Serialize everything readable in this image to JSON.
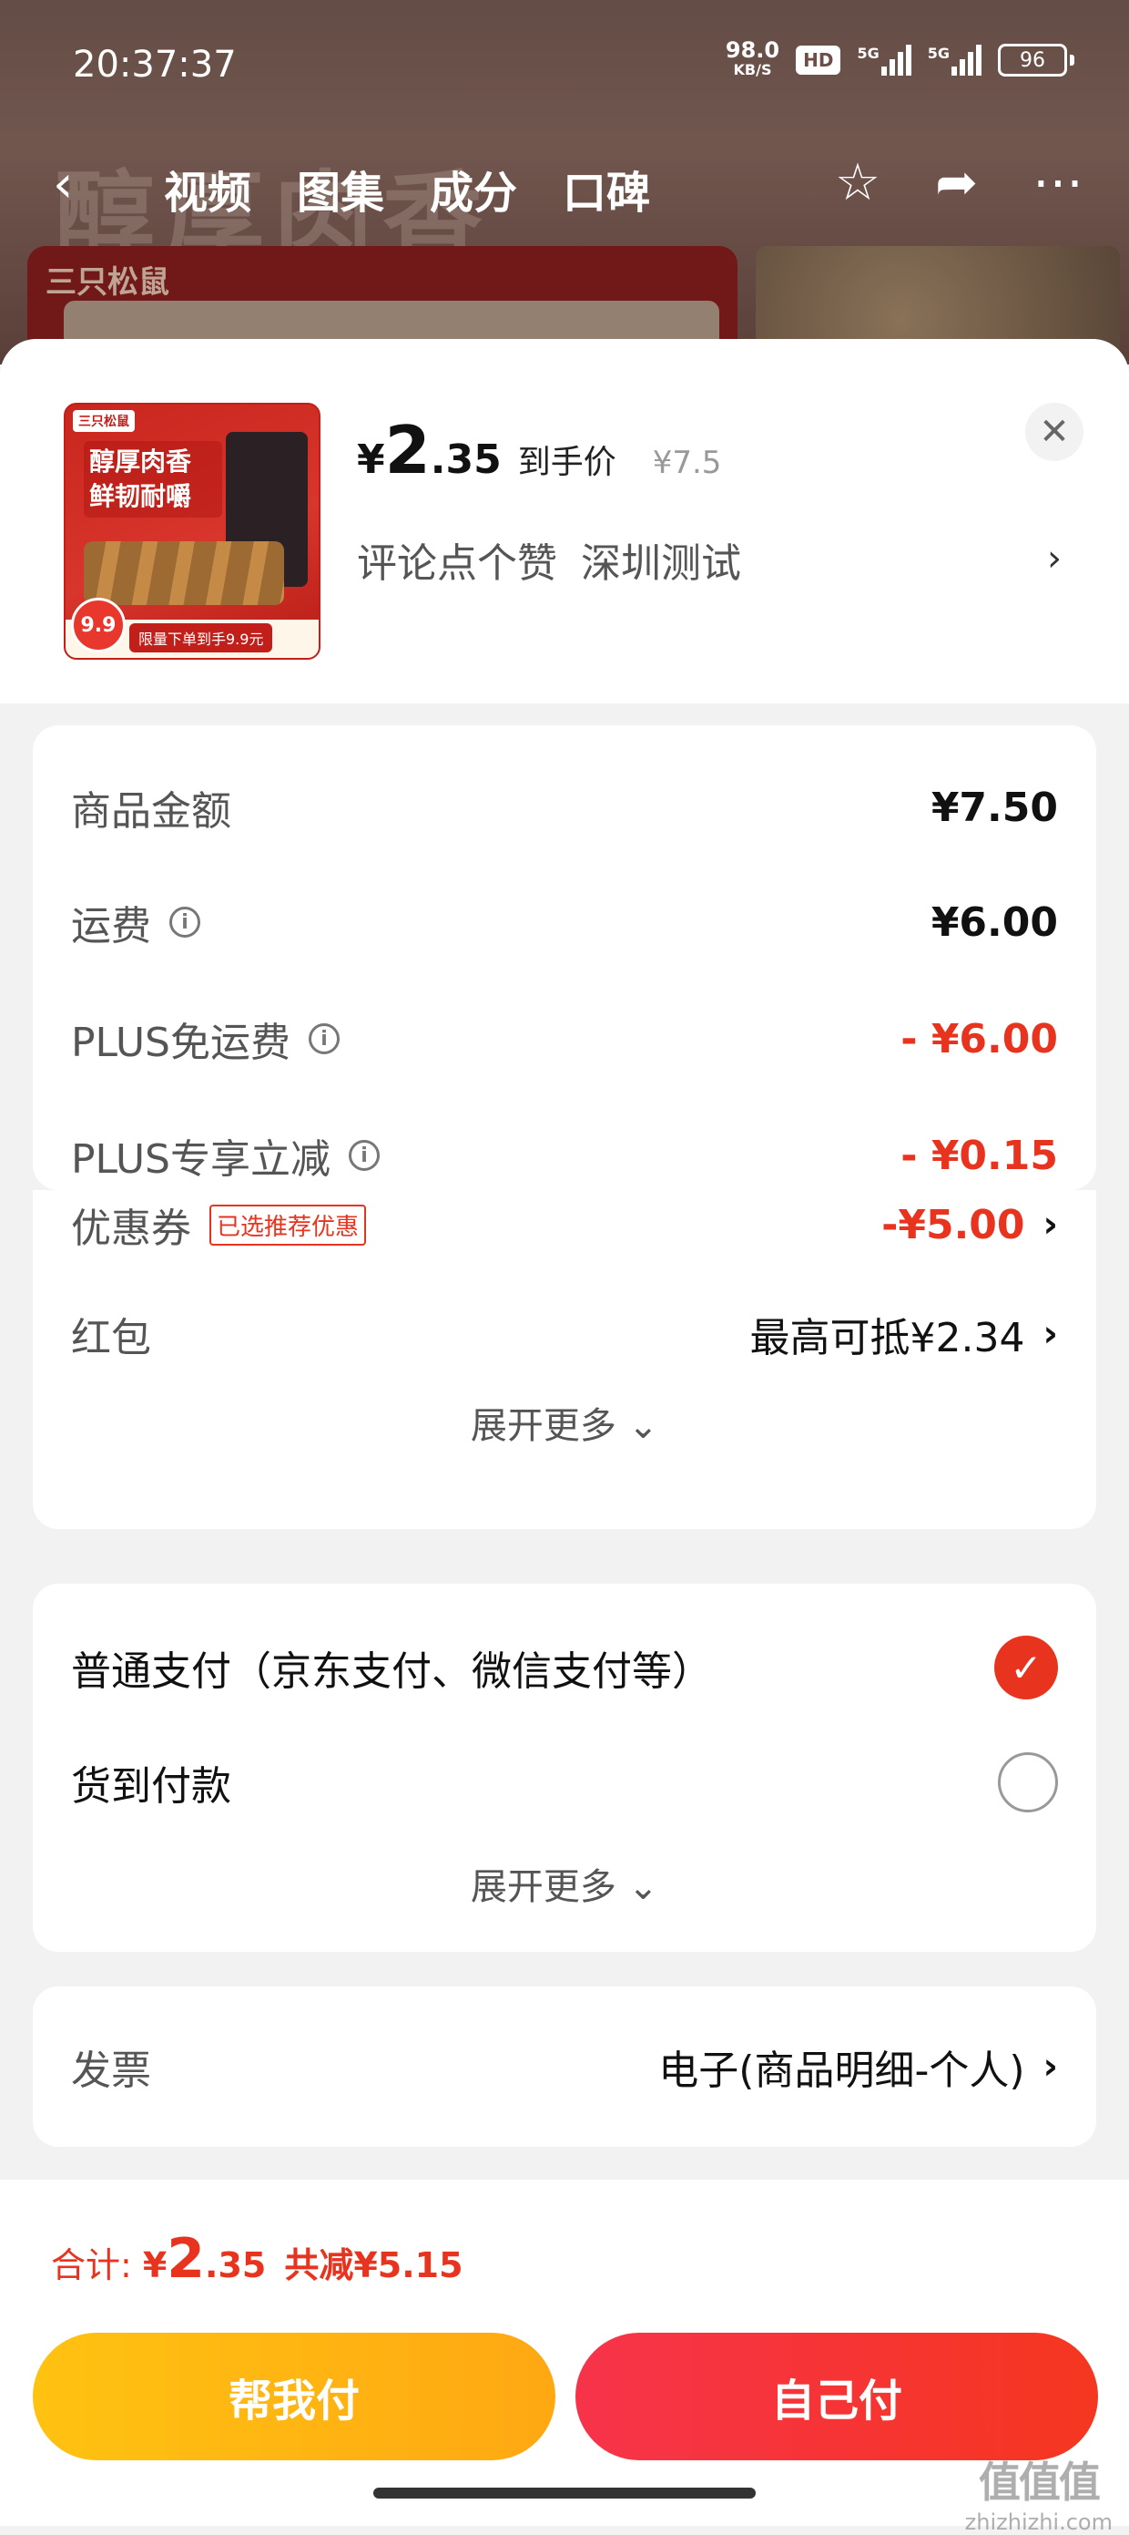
{
  "status_bar": {
    "time": "20:37:37",
    "net_speed": "98.0",
    "net_unit": "KB/S",
    "hd_label": "HD",
    "sim1_label": "5G",
    "sim2_label": "5G",
    "battery": "96"
  },
  "top_nav": {
    "tabs": [
      {
        "label": "视频"
      },
      {
        "label": "图集"
      },
      {
        "label": "成分"
      },
      {
        "label": "口碑"
      }
    ],
    "brand_text": "三只松鼠",
    "banner_text": "醇厚肉香"
  },
  "product": {
    "thumb": {
      "brand": "三只松鼠",
      "title_line1": "醇厚肉香",
      "title_line2": "鲜韧耐嚼",
      "bar_text": "限量下单到手9.9元",
      "badge": "9.9"
    },
    "price_currency": "¥",
    "price_int": "2",
    "price_dec": ".35",
    "price_label": "到手价",
    "original_price": "¥7.5",
    "promo_items": [
      "评论点个赞",
      "深圳测试"
    ]
  },
  "summary": {
    "rows": [
      {
        "label": "商品金额",
        "value": "¥7.50"
      },
      {
        "label": "运费",
        "value": "¥6.00"
      },
      {
        "label": "PLUS免运费",
        "value": "- ¥6.00"
      },
      {
        "label": "PLUS专享立减",
        "value": "- ¥0.15"
      },
      {
        "label": "优惠券",
        "tag": "已选推荐优惠",
        "value": "-¥5.00"
      },
      {
        "label": "红包",
        "value": "最高可抵¥2.34"
      }
    ],
    "expand_label": "展开更多"
  },
  "payment": {
    "options": [
      {
        "label": "普通支付（京东支付、微信支付等）",
        "selected": true
      },
      {
        "label": "货到付款",
        "selected": false
      }
    ],
    "expand_label": "展开更多"
  },
  "invoice": {
    "label": "发票",
    "value": "电子(商品明细-个人)"
  },
  "footer": {
    "total_label": "合计:",
    "total_currency": "¥",
    "total_int": "2",
    "total_dec": ".35",
    "saved": "共减¥5.15",
    "help_pay_label": "帮我付",
    "self_pay_label": "自己付"
  },
  "watermark": {
    "main": "值值值",
    "sub": "zhizhizhi.com"
  },
  "colors": {
    "accent_red": "#e8331f",
    "button_yellow": "#ffb511",
    "button_red": "#f5361f"
  }
}
